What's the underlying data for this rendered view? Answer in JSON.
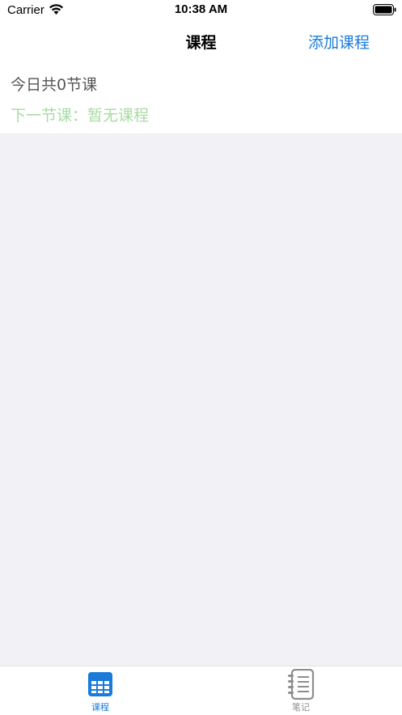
{
  "status_bar": {
    "carrier": "Carrier",
    "time": "10:38 AM",
    "icons": [
      "wifi-icon",
      "battery-icon"
    ]
  },
  "nav": {
    "title": "课程",
    "add_course_label": "添加课程"
  },
  "summary": {
    "today_count": "今日共0节课",
    "next_class": "下一节课：暂无课程"
  },
  "tabs": [
    {
      "label": "课程",
      "icon": "calendar-grid-icon",
      "selected": true
    },
    {
      "label": "笔记",
      "icon": "notebook-icon",
      "selected": false
    }
  ],
  "colors": {
    "accent": "#1a7bd8",
    "next_class_text": "#a8dba4",
    "content_background": "#f1f1f6",
    "inactive_tab": "#8e8e8e"
  }
}
